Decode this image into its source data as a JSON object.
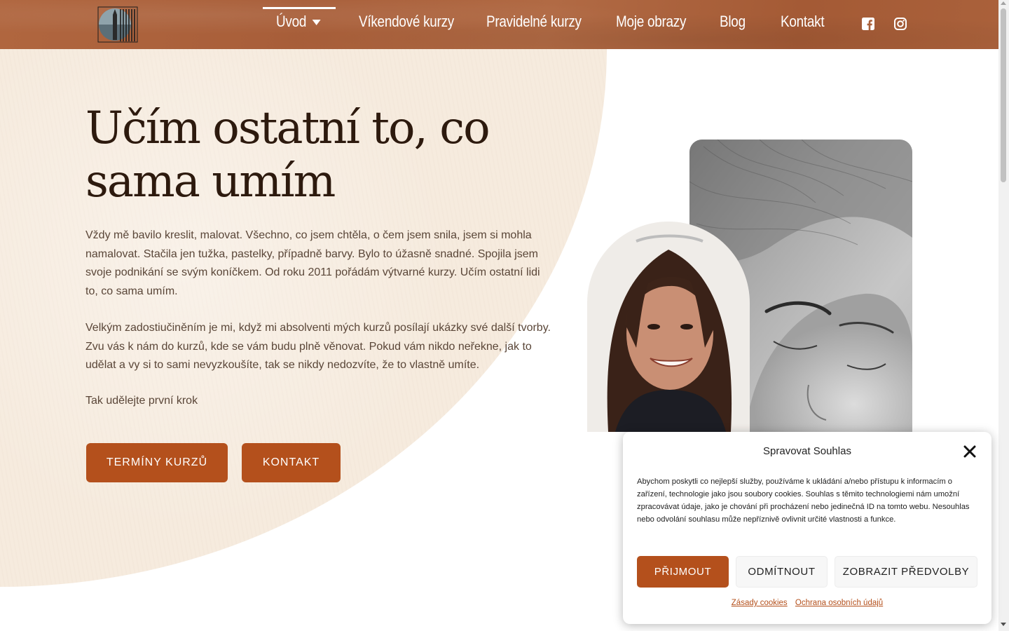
{
  "nav": {
    "items": [
      {
        "label": "Úvod"
      },
      {
        "label": "Víkendové kurzy"
      },
      {
        "label": "Pravidelné kurzy"
      },
      {
        "label": "Moje obrazy"
      },
      {
        "label": "Blog"
      },
      {
        "label": "Kontakt"
      }
    ],
    "social": [
      "facebook-icon",
      "instagram-icon"
    ]
  },
  "hero": {
    "title": "Učím ostatní to, co sama umím",
    "paragraphs": [
      "Vždy mě bavilo kreslit, malovat. Všechno, co jsem chtěla, o čem jsem snila, jsem si mohla namalovat. Stačila jen tužka, pastelky, případně barvy. Bylo to úžasně snadné. Spojila jsem svoje podnikání se svým koníčkem. Od roku 2011 pořádám výtvarné kurzy. Učím ostatní lidi to, co sama umím.",
      "Velkým zadostiučiněním je mi, když mi absolventi mých kurzů posílají ukázky své další tvorby. Zvu vás k nám do kurzů, kde se vám budu plně věnovat. Pokud vám nikdo neřekne, jak to udělat a vy si to sami nevyzkoušíte, tak se nikdy nedozvíte, že to vlastně umíte.",
      "Tak udělejte první krok"
    ],
    "buttons": {
      "terms": "TERMÍNY KURZŮ",
      "contact": "KONTAKT"
    }
  },
  "cookie": {
    "title": "Spravovat Souhlas",
    "text": "Abychom poskytli co nejlepší služby, používáme k ukládání a/nebo přístupu k informacím o zařízení, technologie jako jsou soubory cookies. Souhlas s těmito technologiemi nám umožní zpracovávat údaje, jako je chování při procházení nebo jedinečná ID na tomto webu. Nesouhlas nebo odvolání souhlasu může nepříznivě ovlivnit určité vlastnosti a funkce.",
    "accept": "PŘIJMOUT",
    "decline": "ODMÍTNOUT",
    "preferences": "ZOBRAZIT PŘEDVOLBY",
    "links": {
      "cookies": "Zásady cookies",
      "privacy": "Ochrana osobních údajů"
    }
  },
  "colors": {
    "header": "#aa613b",
    "accent": "#b4501c",
    "hero_bg": "#f6ebde",
    "title": "#2d1a0e"
  }
}
